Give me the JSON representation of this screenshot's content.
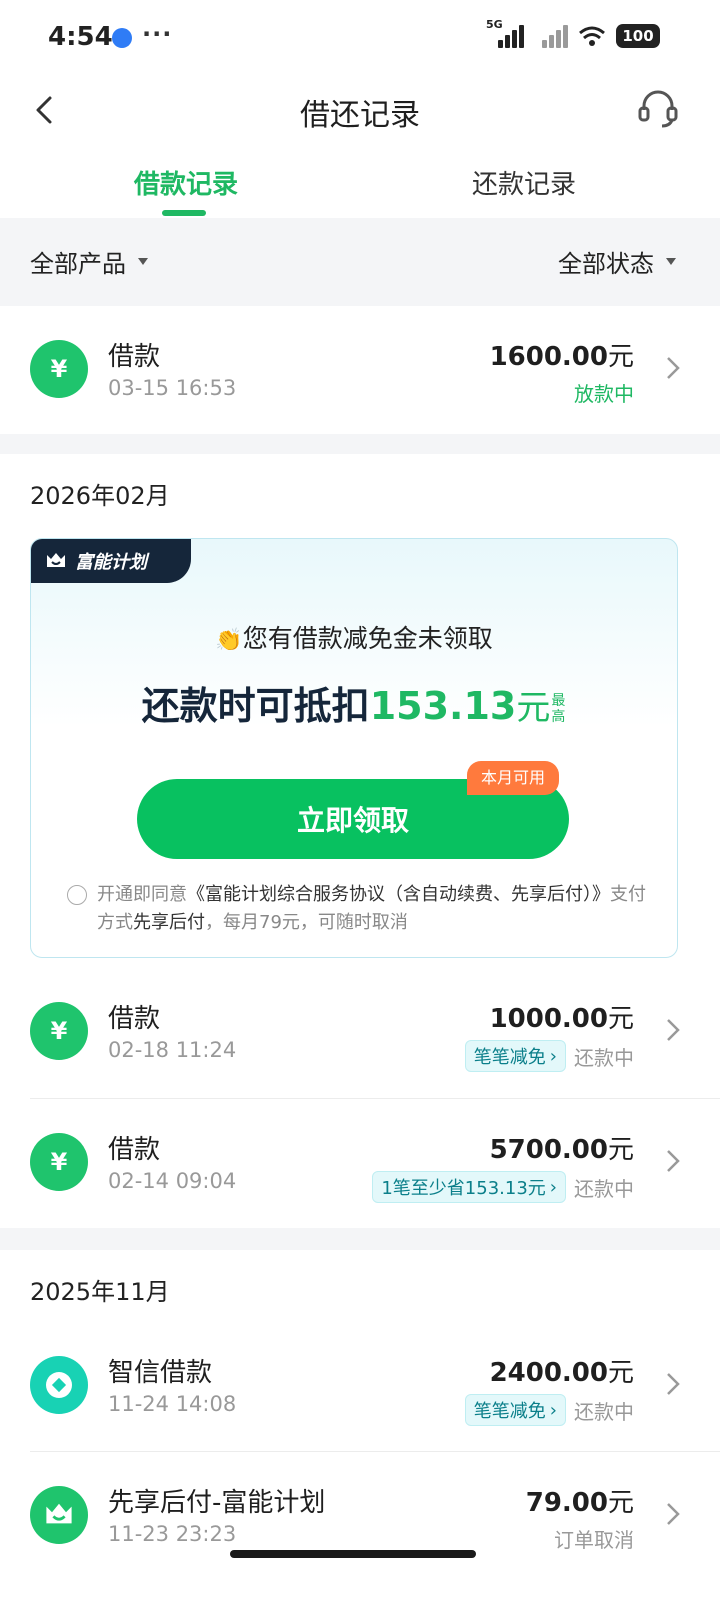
{
  "status_bar": {
    "time": "4:54",
    "more": "···",
    "net": "5G",
    "battery": "100"
  },
  "nav": {
    "title": "借还记录"
  },
  "tabs": [
    {
      "label": "借款记录"
    },
    {
      "label": "还款记录"
    }
  ],
  "filters": {
    "product": "全部产品",
    "status": "全部状态"
  },
  "top_record": {
    "title": "借款",
    "time": "03-15 16:53",
    "amount": "1600.00",
    "unit": "元",
    "status": "放款中"
  },
  "months": [
    {
      "label": "2026年02月"
    },
    {
      "label": "2025年11月"
    }
  ],
  "promo": {
    "tag": "富能计划",
    "clap": "👏",
    "headline": "您有借款减免金未领取",
    "deduct_prefix": "还款时可抵扣",
    "deduct_amount": "153.13",
    "deduct_unit": "元",
    "deduct_max": "最高",
    "button": "立即领取",
    "button_badge": "本月可用",
    "agree_a": "开通即同意",
    "agree_b": "《富能计划综合服务协议（含自动续费、先享后付）》",
    "agree_c": "支付方式",
    "agree_d": "先享后付",
    "agree_e": "，每月79元，可随时取消"
  },
  "records": [
    {
      "title": "借款",
      "time": "02-18 11:24",
      "amount": "1000.00",
      "unit": "元",
      "badge": "笔笔减免",
      "status": "还款中"
    },
    {
      "title": "借款",
      "time": "02-14 09:04",
      "amount": "5700.00",
      "unit": "元",
      "badge": "1笔至少省153.13元",
      "status": "还款中"
    },
    {
      "title": "智信借款",
      "time": "11-24 14:08",
      "amount": "2400.00",
      "unit": "元",
      "badge": "笔笔减免",
      "status": "还款中"
    },
    {
      "title": "先享后付-富能计划",
      "time": "11-23 23:23",
      "amount": "79.00",
      "unit": "元",
      "status": "订单取消"
    }
  ],
  "icons": {
    "loan": "yen-icon",
    "zhixin": "coin-icon",
    "plan": "crown-icon"
  },
  "colors": {
    "accent": "#1fb863",
    "button": "#08c160",
    "badge_orange": "#ff7a3d",
    "tag_dark": "#15263a"
  }
}
